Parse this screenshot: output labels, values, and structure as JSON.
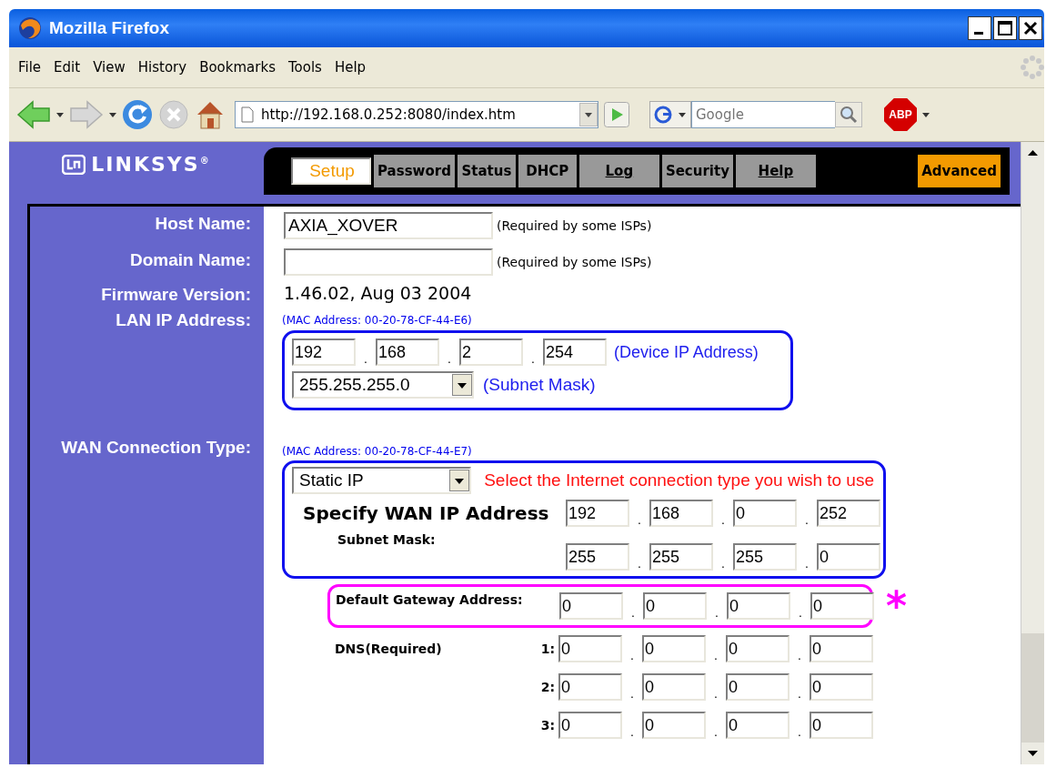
{
  "window": {
    "title": "Mozilla Firefox"
  },
  "menu": [
    {
      "label": "File"
    },
    {
      "label": "Edit"
    },
    {
      "label": "View"
    },
    {
      "label": "History"
    },
    {
      "label": "Bookmarks"
    },
    {
      "label": "Tools"
    },
    {
      "label": "Help"
    }
  ],
  "toolbar": {
    "address": "http://192.168.0.252:8080/index.htm",
    "search_placeholder": "Google",
    "adblock_label": "ABP"
  },
  "router": {
    "logo": "LINKSYS",
    "logo_mark": "®",
    "tabs": [
      {
        "label": "Setup",
        "kind": "plain",
        "selected": true
      },
      {
        "label": "Password",
        "kind": "plain",
        "selected": false
      },
      {
        "label": "Status",
        "kind": "plain",
        "selected": false
      },
      {
        "label": "DHCP",
        "kind": "plain",
        "selected": false
      },
      {
        "label": "Log",
        "kind": "link",
        "selected": false
      },
      {
        "label": "Security",
        "kind": "plain",
        "selected": false
      },
      {
        "label": "Help",
        "kind": "link",
        "selected": false
      },
      {
        "label": "Advanced",
        "kind": "advanced",
        "selected": false
      }
    ],
    "host_name": {
      "label": "Host Name:",
      "value": "AXIA_XOVER",
      "note": "(Required by some ISPs)"
    },
    "domain_name": {
      "label": "Domain Name:",
      "note": "(Required by some ISPs)"
    },
    "firmware": {
      "label": "Firmware Version:",
      "value": "1.46.02, Aug 03 2004"
    },
    "lan": {
      "label": "LAN IP Address:",
      "mac": "(MAC Address: 00-20-78-CF-44-E6)",
      "separator": ".",
      "ip": [
        "192",
        "168",
        "2",
        "254"
      ],
      "ip_note": "(Device IP Address)",
      "subnet": "255.255.255.0",
      "subnet_note": "(Subnet Mask)"
    },
    "wan": {
      "label": "WAN Connection Type:",
      "mac": "(MAC Address: 00-20-78-CF-44-E7)",
      "type": "Static IP",
      "hint": "Select the Internet connection type you wish to use",
      "ip_label": "Specify WAN IP Address",
      "ip_separator": ".",
      "ip": [
        "192",
        "168",
        "0",
        "252"
      ],
      "mask_label": "Subnet Mask:",
      "mask_separator": ".",
      "mask": [
        "255",
        "255",
        "255",
        "0"
      ],
      "gateway_label": "Default Gateway Address:",
      "gateway_separator": ".",
      "gateway": [
        "0",
        "0",
        "0",
        "0"
      ],
      "gateway_mark": "*",
      "dns_label": "DNS(Required)",
      "dns": [
        {
          "label": "1:",
          "separator": ".",
          "octets": [
            "0",
            "0",
            "0",
            "0"
          ]
        },
        {
          "label": "2:",
          "separator": ".",
          "octets": [
            "0",
            "0",
            "0",
            "0"
          ]
        },
        {
          "label": "3:",
          "separator": ".",
          "octets": [
            "0",
            "0",
            "0",
            "0"
          ]
        }
      ]
    }
  }
}
